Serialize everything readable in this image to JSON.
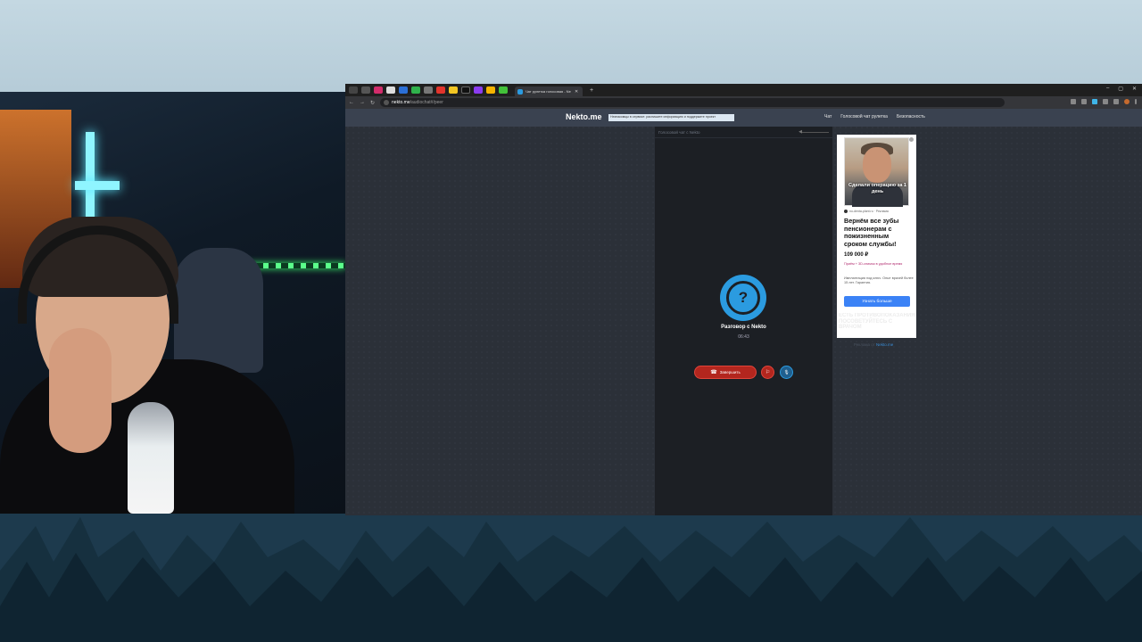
{
  "browser": {
    "tab_title": "Чат рулетка голосовая - Ne",
    "url_domain": "nekto.me",
    "url_path": "/audiochat#/peer",
    "new_tab": "+",
    "window_controls": [
      "–",
      "▢",
      "✕"
    ]
  },
  "site": {
    "logo": "Nekto.me",
    "notice": "Незнакомцы в сервисе: распишите информацию и поддержите проект",
    "nav": [
      "Чат",
      "Голосовой чат рулетка",
      "Безопасность"
    ]
  },
  "chat": {
    "header_title": "Голосовой чат с Nekto",
    "avatar_glyph": "?",
    "call_title": "Разговор с Nekto",
    "timer": "06:43",
    "end_button": "Завершить",
    "end_icon": "☎",
    "report_icon": "⚐",
    "mic_icon": "🎙"
  },
  "ad": {
    "image_caption": "Сделали операцию за 1 день",
    "source": "no-denta-plant.ru · Реклама",
    "title": "Вернём все зубы пенсионерам с пожизненным сроком службы!",
    "price": "109 000 ₽",
    "promo": "Приём + 3D-снимок в удобное время",
    "description": "Имплантация под ключ. Опыт врачей более 15 лет. Гарантия.",
    "cta": "Узнать больше",
    "ghost_text": "ЕСТЬ ПРОТИВОПОКАЗАНИЯ ПОСОВЕТУЙТЕСЬ С ВРАЧОМ",
    "footer_prefix": "Реклама от",
    "footer_link": "Nekto.me"
  },
  "colors": {
    "accent": "#2b9be0",
    "danger": "#b3261e",
    "cta": "#3b82f6"
  }
}
